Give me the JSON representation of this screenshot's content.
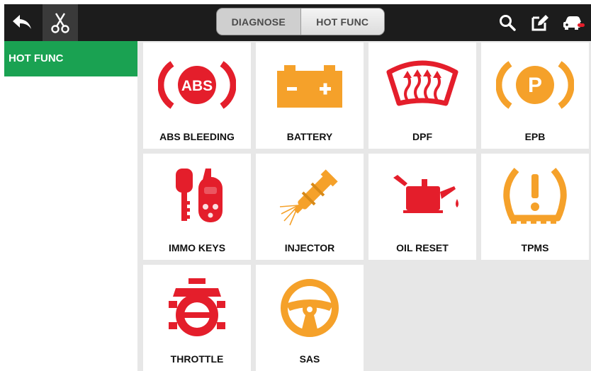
{
  "toolbar": {
    "back_icon": "back-arrow-icon",
    "cut_icon": "scissors-icon",
    "search_icon": "search-icon",
    "edit_icon": "edit-icon",
    "car_icon": "car-icon"
  },
  "tabs": [
    {
      "label": "DIAGNOSE",
      "active": false
    },
    {
      "label": "HOT FUNC",
      "active": true
    }
  ],
  "sidebar": {
    "items": [
      {
        "label": "HOT FUNC",
        "selected": true
      }
    ]
  },
  "functions": [
    {
      "label": "ABS BLEEDING",
      "icon": "abs-icon",
      "color": "#e41e2b"
    },
    {
      "label": "BATTERY",
      "icon": "battery-icon",
      "color": "#f5a12a"
    },
    {
      "label": "DPF",
      "icon": "dpf-icon",
      "color": "#e41e2b"
    },
    {
      "label": "EPB",
      "icon": "parking-brake-icon",
      "color": "#f5a12a"
    },
    {
      "label": "IMMO KEYS",
      "icon": "car-keys-icon",
      "color": "#e41e2b"
    },
    {
      "label": "INJECTOR",
      "icon": "injector-icon",
      "color": "#f5a12a"
    },
    {
      "label": "OIL RESET",
      "icon": "oil-can-icon",
      "color": "#e41e2b"
    },
    {
      "label": "TPMS",
      "icon": "tire-pressure-icon",
      "color": "#f5a12a"
    },
    {
      "label": "THROTTLE",
      "icon": "throttle-icon",
      "color": "#e41e2b"
    },
    {
      "label": "SAS",
      "icon": "steering-wheel-icon",
      "color": "#f5a12a"
    }
  ],
  "colors": {
    "accent_green": "#1aa252",
    "red": "#e41e2b",
    "orange": "#f5a12a",
    "topbar": "#1c1c1c"
  }
}
